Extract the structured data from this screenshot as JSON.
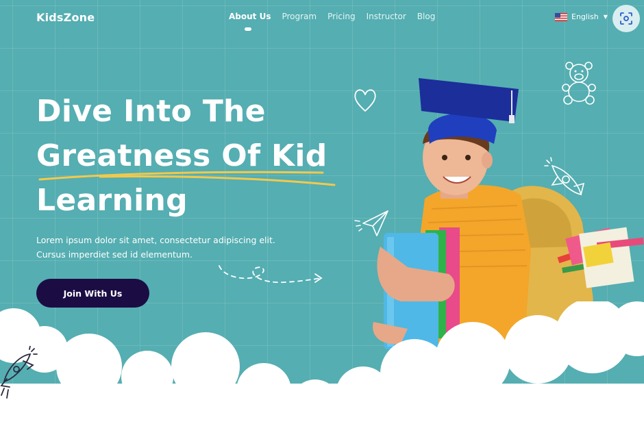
{
  "header": {
    "logo": "KidsZone",
    "nav": [
      {
        "label": "About Us",
        "active": true
      },
      {
        "label": "Program",
        "active": false
      },
      {
        "label": "Pricing",
        "active": false
      },
      {
        "label": "Instructor",
        "active": false
      },
      {
        "label": "Blog",
        "active": false
      }
    ],
    "language": "English"
  },
  "hero": {
    "title_lines": [
      "Dive Into The",
      "Greatness Of Kid",
      "Learning"
    ],
    "description_lines": [
      "Lorem ipsum dolor sit amet, consectetur adipiscing elit.",
      "Cursus imperdiet sed id elementum."
    ],
    "cta_label": "Join With Us"
  },
  "colors": {
    "background": "#55aeb1",
    "cta": "#1c0c44",
    "accent_underline": "#f2c94c",
    "text": "#ffffff"
  },
  "icons": [
    "flag-us-icon",
    "chevron-down-icon",
    "scan-icon",
    "heart-doodle-icon",
    "teddy-bear-doodle-icon",
    "rocket-doodle-icon",
    "paper-plane-doodle-icon",
    "dashed-arrow-doodle-icon"
  ]
}
